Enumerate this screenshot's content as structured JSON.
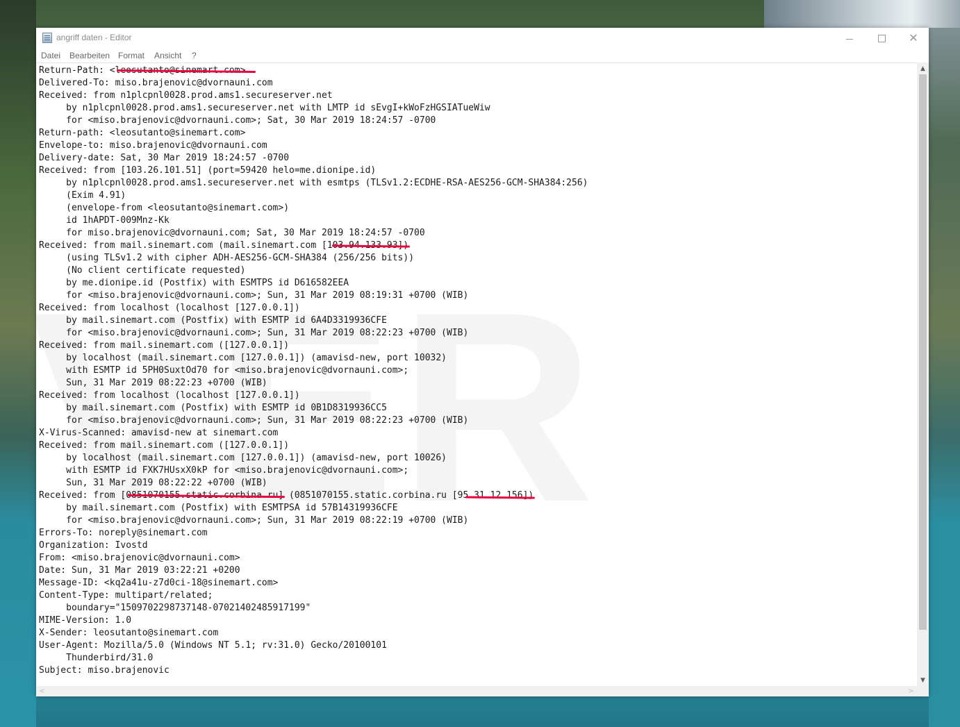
{
  "window": {
    "title": "angriff daten - Editor",
    "minimize_glyph": "",
    "close_glyph": "✕"
  },
  "menu": {
    "datei": "Datei",
    "bearbeiten": "Bearbeiten",
    "format": "Format",
    "ansicht": "Ansicht",
    "help": "?"
  },
  "document": {
    "watermark": "VER",
    "lines": [
      "Return-Path: <leosutanto@sinemart.com>",
      "Delivered-To: miso.brajenovic@dvornauni.com",
      "Received: from n1plcpnl0028.prod.ams1.secureserver.net",
      "     by n1plcpnl0028.prod.ams1.secureserver.net with LMTP id sEvgI+kWoFzHGSIATueWiw",
      "     for <miso.brajenovic@dvornauni.com>; Sat, 30 Mar 2019 18:24:57 -0700",
      "Return-path: <leosutanto@sinemart.com>",
      "Envelope-to: miso.brajenovic@dvornauni.com",
      "Delivery-date: Sat, 30 Mar 2019 18:24:57 -0700",
      "Received: from [103.26.101.51] (port=59420 helo=me.dionipe.id)",
      "     by n1plcpnl0028.prod.ams1.secureserver.net with esmtps (TLSv1.2:ECDHE-RSA-AES256-GCM-SHA384:256)",
      "     (Exim 4.91)",
      "     (envelope-from <leosutanto@sinemart.com>)",
      "     id 1hAPDT-009Mnz-Kk",
      "     for miso.brajenovic@dvornauni.com; Sat, 30 Mar 2019 18:24:57 -0700",
      "Received: from mail.sinemart.com (mail.sinemart.com [103.94.133.93])",
      "     (using TLSv1.2 with cipher ADH-AES256-GCM-SHA384 (256/256 bits))",
      "     (No client certificate requested)",
      "     by me.dionipe.id (Postfix) with ESMTPS id D616582EEA",
      "     for <miso.brajenovic@dvornauni.com>; Sun, 31 Mar 2019 08:19:31 +0700 (WIB)",
      "Received: from localhost (localhost [127.0.0.1])",
      "     by mail.sinemart.com (Postfix) with ESMTP id 6A4D3319936CFE",
      "     for <miso.brajenovic@dvornauni.com>; Sun, 31 Mar 2019 08:22:23 +0700 (WIB)",
      "Received: from mail.sinemart.com ([127.0.0.1])",
      "     by localhost (mail.sinemart.com [127.0.0.1]) (amavisd-new, port 10032)",
      "     with ESMTP id 5PH0SuxtOd70 for <miso.brajenovic@dvornauni.com>;",
      "     Sun, 31 Mar 2019 08:22:23 +0700 (WIB)",
      "Received: from localhost (localhost [127.0.0.1])",
      "     by mail.sinemart.com (Postfix) with ESMTP id 0B1D8319936CC5",
      "     for <miso.brajenovic@dvornauni.com>; Sun, 31 Mar 2019 08:22:23 +0700 (WIB)",
      "X-Virus-Scanned: amavisd-new at sinemart.com",
      "Received: from mail.sinemart.com ([127.0.0.1])",
      "     by localhost (mail.sinemart.com [127.0.0.1]) (amavisd-new, port 10026)",
      "     with ESMTP id FXK7HUsxX0kP for <miso.brajenovic@dvornauni.com>;",
      "     Sun, 31 Mar 2019 08:22:22 +0700 (WIB)",
      "Received: from [0851070155.static.corbina.ru] (0851070155.static.corbina.ru [95.31.12.156])",
      "     by mail.sinemart.com (Postfix) with ESMTPSA id 57B14319936CFE",
      "     for <miso.brajenovic@dvornauni.com>; Sun, 31 Mar 2019 08:22:19 +0700 (WIB)",
      "Errors-To: noreply@sinemart.com",
      "Organization: Ivostd",
      "From: <miso.brajenovic@dvornauni.com>",
      "Date: Sun, 31 Mar 2019 03:22:21 +0200",
      "Message-ID: <kq2a41u-z7d0ci-18@sinemart.com>",
      "Content-Type: multipart/related;",
      "     boundary=\"1509702298737148-07021402485917199\"",
      "MIME-Version: 1.0",
      "X-Sender: leosutanto@sinemart.com",
      "User-Agent: Mozilla/5.0 (Windows NT 5.1; rv:31.0) Gecko/20100101",
      "     Thunderbird/31.0",
      "Subject: miso.brajenovic"
    ]
  },
  "scrollbar": {
    "up_glyph": "▲",
    "down_glyph": "▼",
    "left_glyph": "<",
    "right_glyph": ">"
  },
  "colors": {
    "annotation_underline": "#e8003f"
  }
}
